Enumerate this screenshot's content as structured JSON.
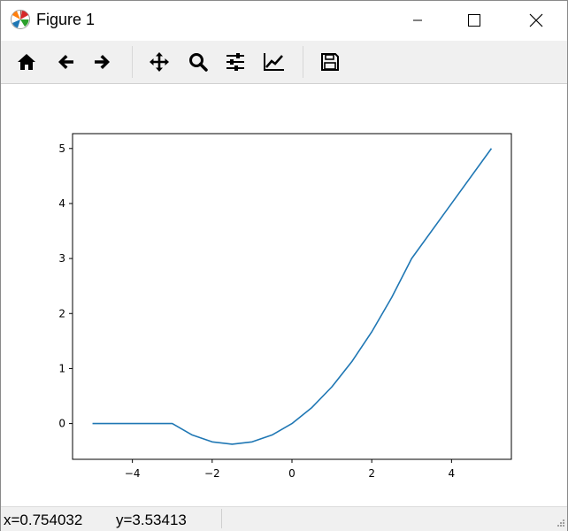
{
  "window": {
    "title": "Figure 1"
  },
  "toolbar": {
    "buttons": [
      {
        "name": "home-icon"
      },
      {
        "name": "back-arrow-icon"
      },
      {
        "name": "forward-arrow-icon"
      },
      {
        "name": "pan-icon"
      },
      {
        "name": "zoom-icon"
      },
      {
        "name": "configure-subplots-icon"
      },
      {
        "name": "edit-axis-icon"
      },
      {
        "name": "save-icon"
      }
    ]
  },
  "status": {
    "x_text": "x=0.754032",
    "y_text": "y=3.53413"
  },
  "colors": {
    "line": "#1f77b4",
    "toolbar_bg": "#f0f0f0"
  },
  "chart_data": {
    "type": "line",
    "title": "",
    "xlabel": "",
    "ylabel": "",
    "xlim": [
      -5.5,
      5.5
    ],
    "ylim": [
      -0.65,
      5.27
    ],
    "xticks": [
      -4,
      -2,
      0,
      2,
      4
    ],
    "xtick_labels": [
      "−4",
      "−2",
      "0",
      "2",
      "4"
    ],
    "yticks": [
      0,
      1,
      2,
      3,
      4,
      5
    ],
    "ytick_labels": [
      "0",
      "1",
      "2",
      "3",
      "4",
      "5"
    ],
    "grid": false,
    "series": [
      {
        "x": [
          -5,
          -4,
          -3.2,
          -3,
          -2.5,
          -2,
          -1.5,
          -1,
          -0.5,
          0,
          0.5,
          1,
          1.5,
          2,
          2.5,
          3,
          4,
          5
        ],
        "y": [
          0,
          0,
          0,
          0,
          -0.208,
          -0.333,
          -0.375,
          -0.333,
          -0.208,
          0,
          0.292,
          0.667,
          1.125,
          1.667,
          2.292,
          3,
          4,
          5
        ]
      }
    ]
  }
}
